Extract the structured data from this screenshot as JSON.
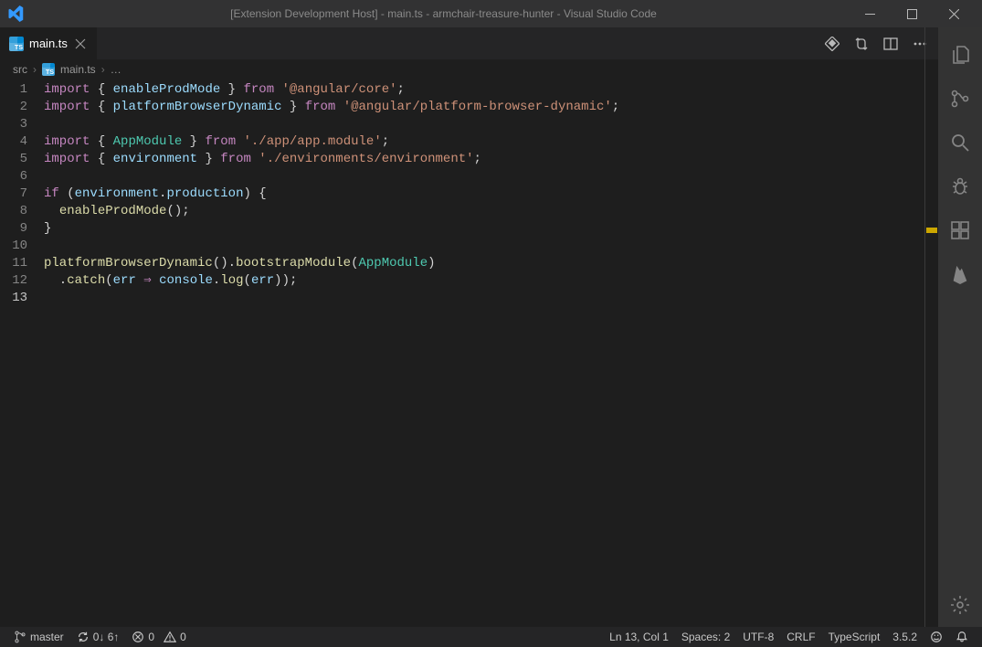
{
  "titlebar": {
    "title": "[Extension Development Host] - main.ts - armchair-treasure-hunter - Visual Studio Code"
  },
  "tab": {
    "label": "main.ts"
  },
  "breadcrumbs": {
    "parts": [
      "src",
      "main.ts",
      "…"
    ]
  },
  "code": {
    "lines": [
      [
        [
          "kw",
          "import"
        ],
        [
          "punc",
          " { "
        ],
        [
          "id",
          "enableProdMode"
        ],
        [
          "punc",
          " } "
        ],
        [
          "kw",
          "from"
        ],
        [
          "punc",
          " "
        ],
        [
          "str",
          "'@angular/core'"
        ],
        [
          "punc",
          ";"
        ]
      ],
      [
        [
          "kw",
          "import"
        ],
        [
          "punc",
          " { "
        ],
        [
          "id",
          "platformBrowserDynamic"
        ],
        [
          "punc",
          " } "
        ],
        [
          "kw",
          "from"
        ],
        [
          "punc",
          " "
        ],
        [
          "str",
          "'@angular/platform-browser-dynamic'"
        ],
        [
          "punc",
          ";"
        ]
      ],
      [],
      [
        [
          "kw",
          "import"
        ],
        [
          "punc",
          " { "
        ],
        [
          "cls",
          "AppModule"
        ],
        [
          "punc",
          " } "
        ],
        [
          "kw",
          "from"
        ],
        [
          "punc",
          " "
        ],
        [
          "str",
          "'./app/app.module'"
        ],
        [
          "punc",
          ";"
        ]
      ],
      [
        [
          "kw",
          "import"
        ],
        [
          "punc",
          " { "
        ],
        [
          "id",
          "environment"
        ],
        [
          "punc",
          " } "
        ],
        [
          "kw",
          "from"
        ],
        [
          "punc",
          " "
        ],
        [
          "str",
          "'./environments/environment'"
        ],
        [
          "punc",
          ";"
        ]
      ],
      [],
      [
        [
          "kw",
          "if"
        ],
        [
          "punc",
          " ("
        ],
        [
          "var",
          "environment"
        ],
        [
          "punc",
          "."
        ],
        [
          "var",
          "production"
        ],
        [
          "punc",
          ") {"
        ]
      ],
      [
        [
          "punc",
          "  "
        ],
        [
          "fn",
          "enableProdMode"
        ],
        [
          "punc",
          "();"
        ]
      ],
      [
        [
          "punc",
          "}"
        ]
      ],
      [],
      [
        [
          "fn",
          "platformBrowserDynamic"
        ],
        [
          "punc",
          "()."
        ],
        [
          "fn",
          "bootstrapModule"
        ],
        [
          "punc",
          "("
        ],
        [
          "cls",
          "AppModule"
        ],
        [
          "punc",
          ")"
        ]
      ],
      [
        [
          "punc",
          "  ."
        ],
        [
          "fn",
          "catch"
        ],
        [
          "punc",
          "("
        ],
        [
          "var",
          "err"
        ],
        [
          "punc",
          " "
        ],
        [
          "kw",
          "⇒"
        ],
        [
          "punc",
          " "
        ],
        [
          "var",
          "console"
        ],
        [
          "punc",
          "."
        ],
        [
          "fn",
          "log"
        ],
        [
          "punc",
          "("
        ],
        [
          "var",
          "err"
        ],
        [
          "punc",
          "));"
        ]
      ],
      []
    ],
    "line_count": 13,
    "current_line": 13
  },
  "status": {
    "branch": "master",
    "sync": "0↓ 6↑",
    "errors": "0",
    "warnings": "0",
    "cursor": "Ln 13, Col 1",
    "spaces": "Spaces: 2",
    "encoding": "UTF-8",
    "eol": "CRLF",
    "language": "TypeScript",
    "tsversion": "3.5.2"
  },
  "icons": {
    "compare": "compare-icon",
    "split": "split-icon",
    "more": "more-icon"
  }
}
